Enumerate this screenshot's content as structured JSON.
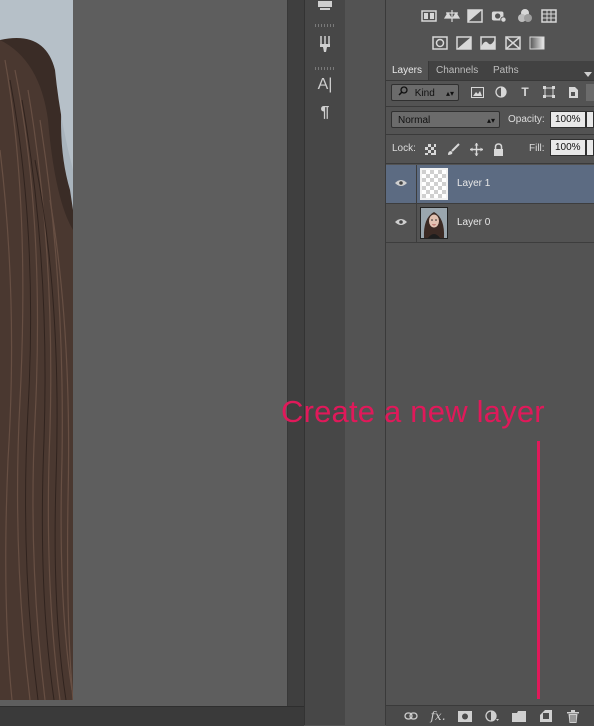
{
  "panel": {
    "tabs": [
      {
        "label": "Layers",
        "active": true
      },
      {
        "label": "Channels",
        "active": false
      },
      {
        "label": "Paths",
        "active": false
      }
    ],
    "filter": {
      "kind_label": "Kind"
    },
    "blend_mode": "Normal",
    "opacity_label": "Opacity:",
    "opacity_value": "100%",
    "lock_label": "Lock:",
    "fill_label": "Fill:",
    "fill_value": "100%",
    "layers": [
      {
        "name": "Layer 1",
        "selected": true,
        "visible": true,
        "thumbnail": "transparent"
      },
      {
        "name": "Layer 0",
        "selected": false,
        "visible": true,
        "thumbnail": "portrait"
      }
    ]
  },
  "tools": [
    "character-tool-icon",
    "paragraph-tool-icon"
  ],
  "tool_labels": {
    "character": "A|",
    "paragraph": "¶"
  },
  "annotation": {
    "text": "Create a new layer",
    "color": "#e0195a"
  },
  "colors": {
    "accent_selection": "#5c6b82",
    "panel_bg": "#535353",
    "annotation": "#e0195a"
  }
}
